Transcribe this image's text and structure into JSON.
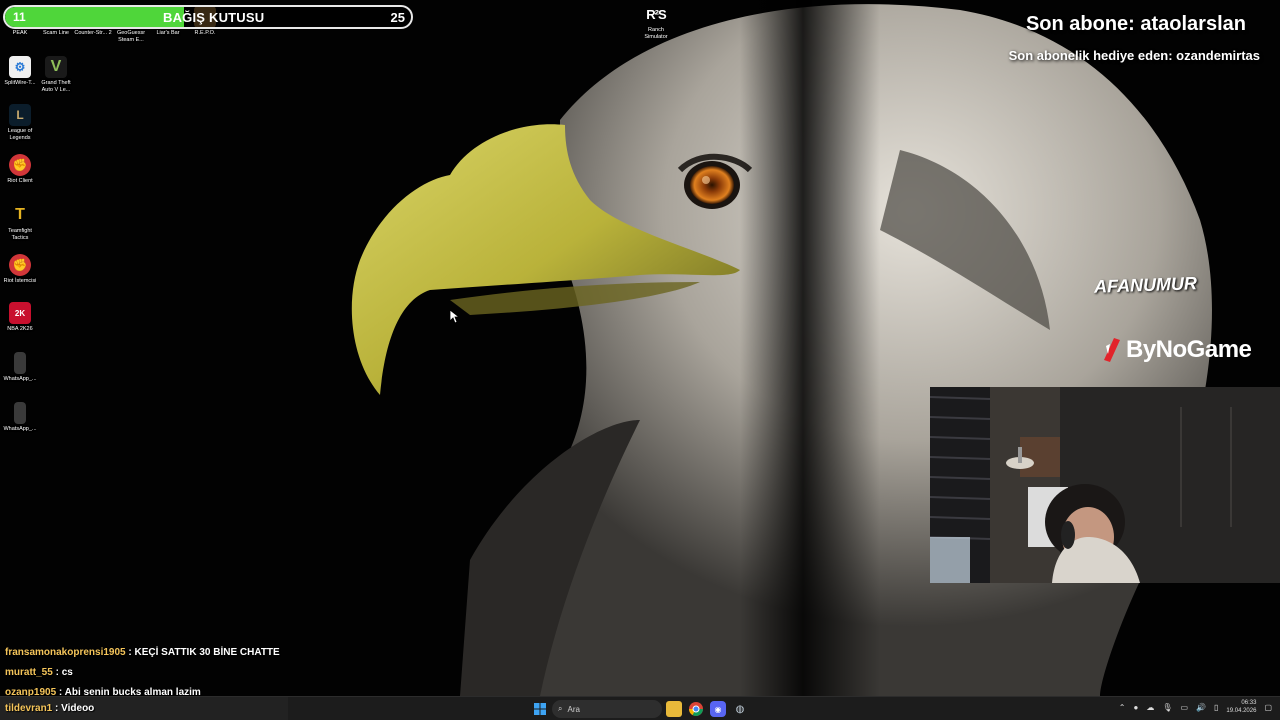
{
  "donation": {
    "min_value": "11",
    "title": "BAĞIŞ KUTUSU",
    "max_value": "25",
    "progress_fraction": 0.44,
    "fill_color": "#4fd63a"
  },
  "top_icons": [
    {
      "label": "PEAK",
      "icon": "peak-icon"
    },
    {
      "label": "Scam Line",
      "icon": "scam-line-icon"
    },
    {
      "label": "Counter-Str... 2",
      "icon": "counter-strike-icon"
    },
    {
      "label": "GeoGuessr Steam E...",
      "icon": "geoguessr-icon"
    },
    {
      "label": "Liar's Bar",
      "icon": "liars-bar-icon"
    },
    {
      "label": "R.E.P.O.",
      "icon": "repo-icon"
    }
  ],
  "desktop_icons": [
    {
      "label": "SplitWire-T...",
      "icon": "splitwire-icon",
      "color": "#ffffff"
    },
    {
      "label": "Grand Theft Auto V Le...",
      "icon": "gta-v-icon",
      "color": "#8fbf5a"
    },
    {
      "label": "League of Legends",
      "icon": "league-of-legends-icon",
      "color": "#c8aa6e"
    },
    {
      "label": "Riot Client",
      "icon": "riot-client-icon",
      "color": "#d13639"
    },
    {
      "label": "Teamfight Tactics",
      "icon": "teamfight-tactics-icon",
      "color": "#e6b422"
    },
    {
      "label": "Riot İstemcisi",
      "icon": "riot-istemcisi-icon",
      "color": "#d13639"
    },
    {
      "label": "NBA 2K26",
      "icon": "nba-2k26-icon",
      "color": "#c8102e"
    },
    {
      "label": "WhatsApp_...",
      "icon": "whatsapp-file-icon",
      "color": "#dddddd"
    },
    {
      "label": "WhatsApp_...",
      "icon": "whatsapp-file-icon",
      "color": "#dddddd"
    }
  ],
  "ranch_icon": {
    "label": "Ranch Simulator",
    "glyph": "R²S",
    "icon": "ranch-simulator-icon"
  },
  "overlay": {
    "last_sub_label": "Son abone: ataolarslan",
    "last_gift_label": "Son abonelik hediye eden: ozandemirtas",
    "sponsor_name": "AFANUMUR",
    "brand_name": "ByNoGame",
    "brand_color": "#e2232a"
  },
  "chat": [
    {
      "user": "fransamonakoprensi1905",
      "message": "KEÇİ SATTIK 30 BİNE CHATTE"
    },
    {
      "user": "muratt_55",
      "message": "cs"
    },
    {
      "user": "ozanp1905",
      "message": "Abi senin bucks alman lazim"
    },
    {
      "user": "tildevran1",
      "message": "Videoo"
    }
  ],
  "taskbar": {
    "search_placeholder": "Ara",
    "clock_time": "06:33",
    "clock_date": "19.04.2026",
    "apps": [
      "windows-start-icon",
      "search-icon",
      "file-explorer-icon",
      "chrome-icon",
      "discord-icon",
      "steam-icon"
    ]
  }
}
